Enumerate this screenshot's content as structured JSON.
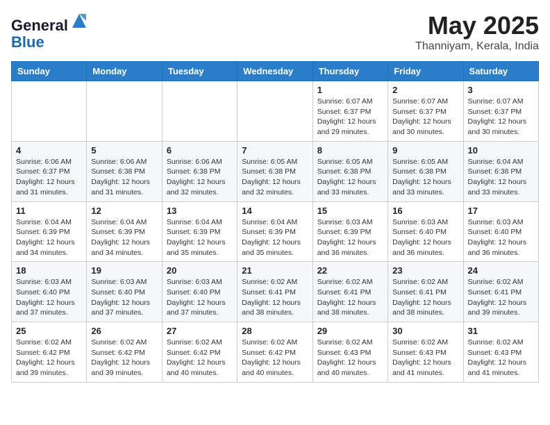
{
  "header": {
    "logo_line1": "General",
    "logo_line2": "Blue",
    "month": "May 2025",
    "location": "Thanniyam, Kerala, India"
  },
  "weekdays": [
    "Sunday",
    "Monday",
    "Tuesday",
    "Wednesday",
    "Thursday",
    "Friday",
    "Saturday"
  ],
  "weeks": [
    [
      {
        "day": "",
        "detail": ""
      },
      {
        "day": "",
        "detail": ""
      },
      {
        "day": "",
        "detail": ""
      },
      {
        "day": "",
        "detail": ""
      },
      {
        "day": "1",
        "detail": "Sunrise: 6:07 AM\nSunset: 6:37 PM\nDaylight: 12 hours\nand 29 minutes."
      },
      {
        "day": "2",
        "detail": "Sunrise: 6:07 AM\nSunset: 6:37 PM\nDaylight: 12 hours\nand 30 minutes."
      },
      {
        "day": "3",
        "detail": "Sunrise: 6:07 AM\nSunset: 6:37 PM\nDaylight: 12 hours\nand 30 minutes."
      }
    ],
    [
      {
        "day": "4",
        "detail": "Sunrise: 6:06 AM\nSunset: 6:37 PM\nDaylight: 12 hours\nand 31 minutes."
      },
      {
        "day": "5",
        "detail": "Sunrise: 6:06 AM\nSunset: 6:38 PM\nDaylight: 12 hours\nand 31 minutes."
      },
      {
        "day": "6",
        "detail": "Sunrise: 6:06 AM\nSunset: 6:38 PM\nDaylight: 12 hours\nand 32 minutes."
      },
      {
        "day": "7",
        "detail": "Sunrise: 6:05 AM\nSunset: 6:38 PM\nDaylight: 12 hours\nand 32 minutes."
      },
      {
        "day": "8",
        "detail": "Sunrise: 6:05 AM\nSunset: 6:38 PM\nDaylight: 12 hours\nand 33 minutes."
      },
      {
        "day": "9",
        "detail": "Sunrise: 6:05 AM\nSunset: 6:38 PM\nDaylight: 12 hours\nand 33 minutes."
      },
      {
        "day": "10",
        "detail": "Sunrise: 6:04 AM\nSunset: 6:38 PM\nDaylight: 12 hours\nand 33 minutes."
      }
    ],
    [
      {
        "day": "11",
        "detail": "Sunrise: 6:04 AM\nSunset: 6:39 PM\nDaylight: 12 hours\nand 34 minutes."
      },
      {
        "day": "12",
        "detail": "Sunrise: 6:04 AM\nSunset: 6:39 PM\nDaylight: 12 hours\nand 34 minutes."
      },
      {
        "day": "13",
        "detail": "Sunrise: 6:04 AM\nSunset: 6:39 PM\nDaylight: 12 hours\nand 35 minutes."
      },
      {
        "day": "14",
        "detail": "Sunrise: 6:04 AM\nSunset: 6:39 PM\nDaylight: 12 hours\nand 35 minutes."
      },
      {
        "day": "15",
        "detail": "Sunrise: 6:03 AM\nSunset: 6:39 PM\nDaylight: 12 hours\nand 36 minutes."
      },
      {
        "day": "16",
        "detail": "Sunrise: 6:03 AM\nSunset: 6:40 PM\nDaylight: 12 hours\nand 36 minutes."
      },
      {
        "day": "17",
        "detail": "Sunrise: 6:03 AM\nSunset: 6:40 PM\nDaylight: 12 hours\nand 36 minutes."
      }
    ],
    [
      {
        "day": "18",
        "detail": "Sunrise: 6:03 AM\nSunset: 6:40 PM\nDaylight: 12 hours\nand 37 minutes."
      },
      {
        "day": "19",
        "detail": "Sunrise: 6:03 AM\nSunset: 6:40 PM\nDaylight: 12 hours\nand 37 minutes."
      },
      {
        "day": "20",
        "detail": "Sunrise: 6:03 AM\nSunset: 6:40 PM\nDaylight: 12 hours\nand 37 minutes."
      },
      {
        "day": "21",
        "detail": "Sunrise: 6:02 AM\nSunset: 6:41 PM\nDaylight: 12 hours\nand 38 minutes."
      },
      {
        "day": "22",
        "detail": "Sunrise: 6:02 AM\nSunset: 6:41 PM\nDaylight: 12 hours\nand 38 minutes."
      },
      {
        "day": "23",
        "detail": "Sunrise: 6:02 AM\nSunset: 6:41 PM\nDaylight: 12 hours\nand 38 minutes."
      },
      {
        "day": "24",
        "detail": "Sunrise: 6:02 AM\nSunset: 6:41 PM\nDaylight: 12 hours\nand 39 minutes."
      }
    ],
    [
      {
        "day": "25",
        "detail": "Sunrise: 6:02 AM\nSunset: 6:42 PM\nDaylight: 12 hours\nand 39 minutes."
      },
      {
        "day": "26",
        "detail": "Sunrise: 6:02 AM\nSunset: 6:42 PM\nDaylight: 12 hours\nand 39 minutes."
      },
      {
        "day": "27",
        "detail": "Sunrise: 6:02 AM\nSunset: 6:42 PM\nDaylight: 12 hours\nand 40 minutes."
      },
      {
        "day": "28",
        "detail": "Sunrise: 6:02 AM\nSunset: 6:42 PM\nDaylight: 12 hours\nand 40 minutes."
      },
      {
        "day": "29",
        "detail": "Sunrise: 6:02 AM\nSunset: 6:43 PM\nDaylight: 12 hours\nand 40 minutes."
      },
      {
        "day": "30",
        "detail": "Sunrise: 6:02 AM\nSunset: 6:43 PM\nDaylight: 12 hours\nand 41 minutes."
      },
      {
        "day": "31",
        "detail": "Sunrise: 6:02 AM\nSunset: 6:43 PM\nDaylight: 12 hours\nand 41 minutes."
      }
    ]
  ]
}
